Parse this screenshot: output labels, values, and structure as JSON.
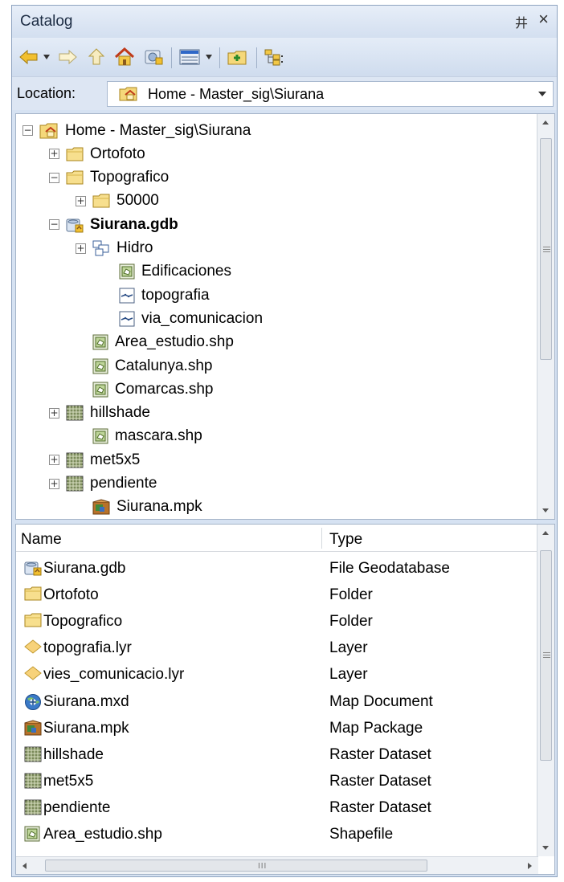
{
  "panel": {
    "title": "Catalog",
    "pin_glyph": "井",
    "close_glyph": "×"
  },
  "toolbar": {
    "icons": [
      "back-arrow-icon",
      "dropdown-arrow-icon",
      "forward-arrow-icon",
      "up-level-icon",
      "home-icon",
      "connect-folder-icon",
      "view-details-icon",
      "view-dropdown-icon",
      "new-folder-icon",
      "toggle-tree-icon"
    ]
  },
  "location": {
    "label": "Location:",
    "value": "Home - Master_sig\\Siurana"
  },
  "tree": {
    "items": [
      {
        "label": "Home - Master_sig\\Siurana",
        "icon": "home-folder",
        "expander": "−",
        "bold": false
      },
      {
        "label": "Ortofoto",
        "icon": "folder",
        "expander": "+",
        "bold": false
      },
      {
        "label": "Topografico",
        "icon": "folder",
        "expander": "−",
        "bold": false
      },
      {
        "label": "50000",
        "icon": "folder",
        "expander": "+",
        "bold": false
      },
      {
        "label": "Siurana.gdb",
        "icon": "geodatabase",
        "expander": "−",
        "bold": true
      },
      {
        "label": "Hidro",
        "icon": "feature-dataset",
        "expander": "+",
        "bold": false
      },
      {
        "label": "Edificaciones",
        "icon": "polygon-feature",
        "expander": "",
        "bold": false
      },
      {
        "label": "topografia",
        "icon": "line-feature",
        "expander": "",
        "bold": false
      },
      {
        "label": "via_comunicacion",
        "icon": "line-feature",
        "expander": "",
        "bold": false
      },
      {
        "label": "Area_estudio.shp",
        "icon": "polygon-feature",
        "expander": "",
        "bold": false
      },
      {
        "label": "Catalunya.shp",
        "icon": "polygon-feature",
        "expander": "",
        "bold": false
      },
      {
        "label": "Comarcas.shp",
        "icon": "polygon-feature",
        "expander": "",
        "bold": false
      },
      {
        "label": "hillshade",
        "icon": "raster",
        "expander": "+",
        "bold": false
      },
      {
        "label": "mascara.shp",
        "icon": "polygon-feature",
        "expander": "",
        "bold": false
      },
      {
        "label": "met5x5",
        "icon": "raster",
        "expander": "+",
        "bold": false
      },
      {
        "label": "pendiente",
        "icon": "raster",
        "expander": "+",
        "bold": false
      },
      {
        "label": "Siurana.mpk",
        "icon": "map-package",
        "expander": "",
        "bold": false
      }
    ]
  },
  "list": {
    "col_name": "Name",
    "col_type": "Type",
    "rows": [
      {
        "name": "Siurana.gdb",
        "type": "File Geodatabase",
        "icon": "geodatabase"
      },
      {
        "name": "Ortofoto",
        "type": "Folder",
        "icon": "folder"
      },
      {
        "name": "Topografico",
        "type": "Folder",
        "icon": "folder"
      },
      {
        "name": "topografia.lyr",
        "type": "Layer",
        "icon": "layer-file"
      },
      {
        "name": "vies_comunicacio.lyr",
        "type": "Layer",
        "icon": "layer-file"
      },
      {
        "name": "Siurana.mxd",
        "type": "Map Document",
        "icon": "map-document"
      },
      {
        "name": "Siurana.mpk",
        "type": "Map Package",
        "icon": "map-package"
      },
      {
        "name": "hillshade",
        "type": "Raster Dataset",
        "icon": "raster"
      },
      {
        "name": "met5x5",
        "type": "Raster Dataset",
        "icon": "raster"
      },
      {
        "name": "pendiente",
        "type": "Raster Dataset",
        "icon": "raster"
      },
      {
        "name": "Area_estudio.shp",
        "type": "Shapefile",
        "icon": "polygon-feature"
      }
    ],
    "hscroll_grip": "III"
  }
}
